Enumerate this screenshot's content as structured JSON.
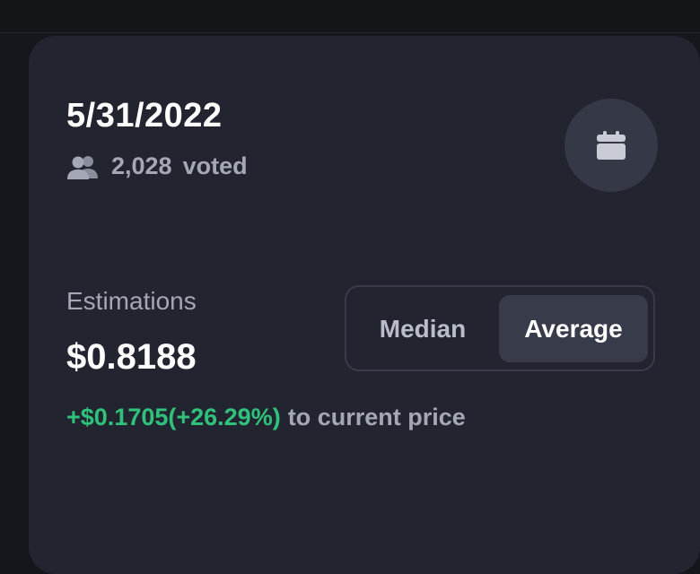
{
  "card": {
    "date": "5/31/2022",
    "voters": {
      "count": "2,028",
      "label": "voted",
      "icon": "users-icon"
    },
    "calendar_button": {
      "icon": "calendar-icon"
    }
  },
  "estimations": {
    "label": "Estimations",
    "value": "$0.8188",
    "change": "+$0.1705(+26.29%)",
    "change_suffix": "to current price",
    "change_color": "#2fc27a"
  },
  "toggle": {
    "options": [
      "Median",
      "Average"
    ],
    "selected": "Average"
  }
}
